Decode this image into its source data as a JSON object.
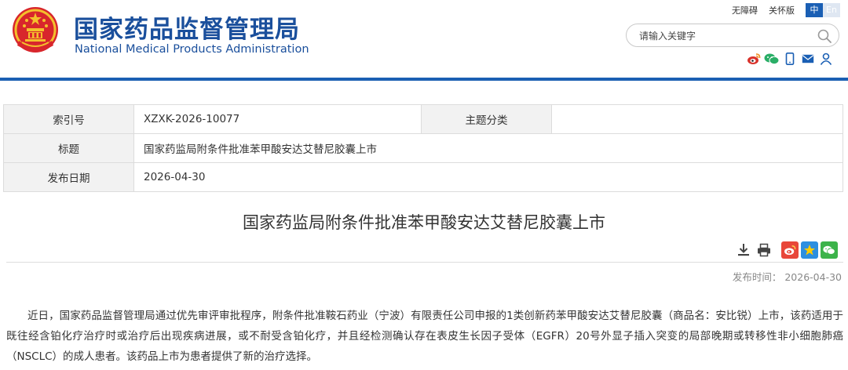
{
  "header": {
    "title_cn": "国家药品监督管理局",
    "title_en": "National Medical Products Administration",
    "toplinks": [
      "无障碍",
      "关怀版"
    ],
    "lang": [
      "中",
      "En"
    ],
    "search_placeholder": "请输入关键字"
  },
  "info": {
    "index_label": "索引号",
    "index_value": "XZXK-2026-10077",
    "category_label": "主题分类",
    "category_value": "",
    "title_label": "标题",
    "title_value": "国家药监局附条件批准苯甲酸安达艾替尼胶囊上市",
    "date_label": "发布日期",
    "date_value": "2026-04-30"
  },
  "article": {
    "title": "国家药监局附条件批准苯甲酸安达艾替尼胶囊上市",
    "pub_label": "发布时间：",
    "pub_value": "2026-04-30",
    "body": "近日，国家药品监督管理局通过优先审评审批程序，附条件批准鞍石药业（宁波）有限责任公司申报的1类创新药苯甲酸安达艾替尼胶囊（商品名：安比锐）上市，该药适用于既往经含铂化疗治疗时或治疗后出现疾病进展，或不耐受含铂化疗，并且经检测确认存在表皮生长因子受体（EGFR）20号外显子插入突变的局部晚期或转移性非小细胞肺癌（NSCLC）的成人患者。该药品上市为患者提供了新的治疗选择。"
  },
  "icons": {
    "emblem": "national-emblem-icon",
    "search": "search-icon",
    "social": [
      "weibo-icon",
      "wechat-icon",
      "mobile-icon",
      "mail-icon",
      "user-icon"
    ],
    "tools": [
      "download-icon",
      "print-icon",
      "weibo-share-icon",
      "qzone-share-icon",
      "wechat-share-icon"
    ]
  },
  "colors": {
    "brand_blue": "#1a4f9c",
    "rule_blue": "#1b5fb3",
    "social_red": "#d9322b",
    "social_green": "#2aae67",
    "social_blue": "#1a5fb4"
  }
}
